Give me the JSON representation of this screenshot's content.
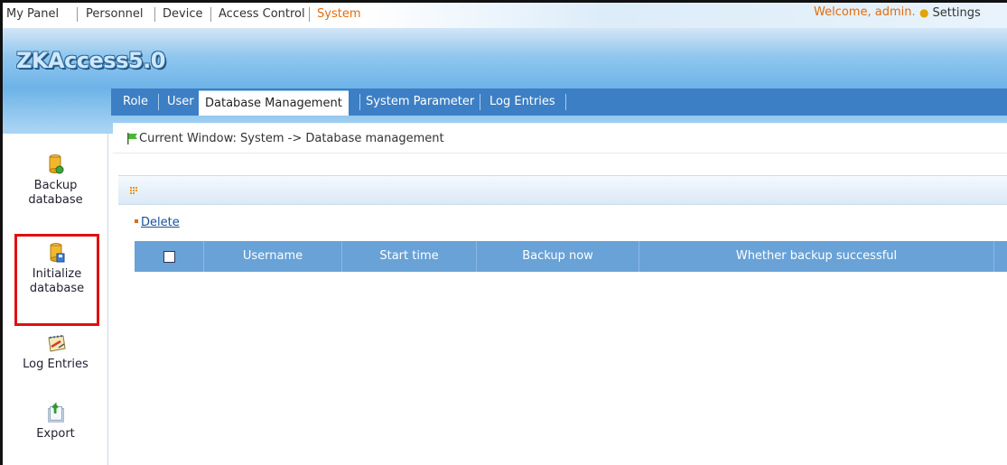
{
  "topnav": {
    "items": [
      "My Panel",
      "Personnel",
      "Device",
      "Access Control",
      "System"
    ],
    "active_index": 4,
    "welcome": "Welcome, admin.",
    "settings": "Settings"
  },
  "logo": {
    "text": "ZKAccess5.0"
  },
  "tabs": [
    {
      "label": "Role"
    },
    {
      "label": "User"
    },
    {
      "label": "Database Management"
    },
    {
      "label": "System Parameter"
    },
    {
      "label": "Log Entries"
    }
  ],
  "active_tab_index": 2,
  "sidebar": {
    "items": [
      {
        "label": "Backup database",
        "icon": "backup-database-icon"
      },
      {
        "label": "Initialize database",
        "icon": "initialize-database-icon"
      },
      {
        "label": "Log Entries",
        "icon": "log-entries-icon"
      },
      {
        "label": "Export",
        "icon": "export-icon"
      }
    ],
    "highlighted_index": 1
  },
  "breadcrumb": {
    "text": "Current Window: System -> Database management"
  },
  "toolbar": {
    "delete_label": "Delete"
  },
  "table": {
    "columns": [
      "",
      "Username",
      "Start time",
      "Backup now",
      "Whether backup successful"
    ],
    "rows": []
  },
  "colors": {
    "accent_orange": "#e36c0a",
    "tab_bar_blue": "#3c7fc4",
    "table_header_blue": "#69a2d7",
    "highlight_red": "#e01010"
  }
}
